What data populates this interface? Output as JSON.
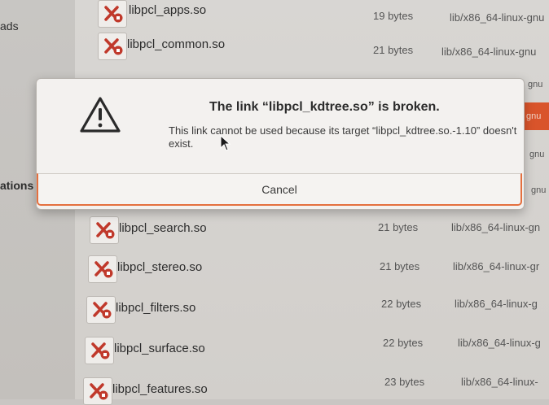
{
  "sidebar": {
    "items": [
      {
        "label": "ads"
      },
      {
        "label": "ations"
      }
    ]
  },
  "files": [
    {
      "name": "libpcl_apps.so",
      "size": "19 bytes",
      "type": "lib/x86_64-linux-gnu"
    },
    {
      "name": "libpcl_common.so",
      "size": "21 bytes",
      "type": "lib/x86_64-linux-gnu"
    },
    {
      "name": "libpcl_search.so",
      "size": "21 bytes",
      "type": "lib/x86_64-linux-gn"
    },
    {
      "name": "libpcl_stereo.so",
      "size": "21 bytes",
      "type": "lib/x86_64-linux-gr"
    },
    {
      "name": "libpcl_filters.so",
      "size": "22 bytes",
      "type": "lib/x86_64-linux-g"
    },
    {
      "name": "libpcl_surface.so",
      "size": "22 bytes",
      "type": "lib/x86_64-linux-g"
    },
    {
      "name": "libpcl_features.so",
      "size": "23 bytes",
      "type": "lib/x86_64-linux-"
    }
  ],
  "peeks": {
    "p1": "gnu",
    "p2": "gnu",
    "p3": "gnu",
    "p4": "gnu"
  },
  "dialog": {
    "title": "The link “libpcl_kdtree.so” is broken.",
    "message": "This link cannot be used because its target “libpcl_kdtree.so.-1.10” doesn't exist.",
    "cancel_label": "Cancel"
  },
  "colors": {
    "accent": "#e46f3e",
    "broken_link_badge": "#d33b2a"
  }
}
